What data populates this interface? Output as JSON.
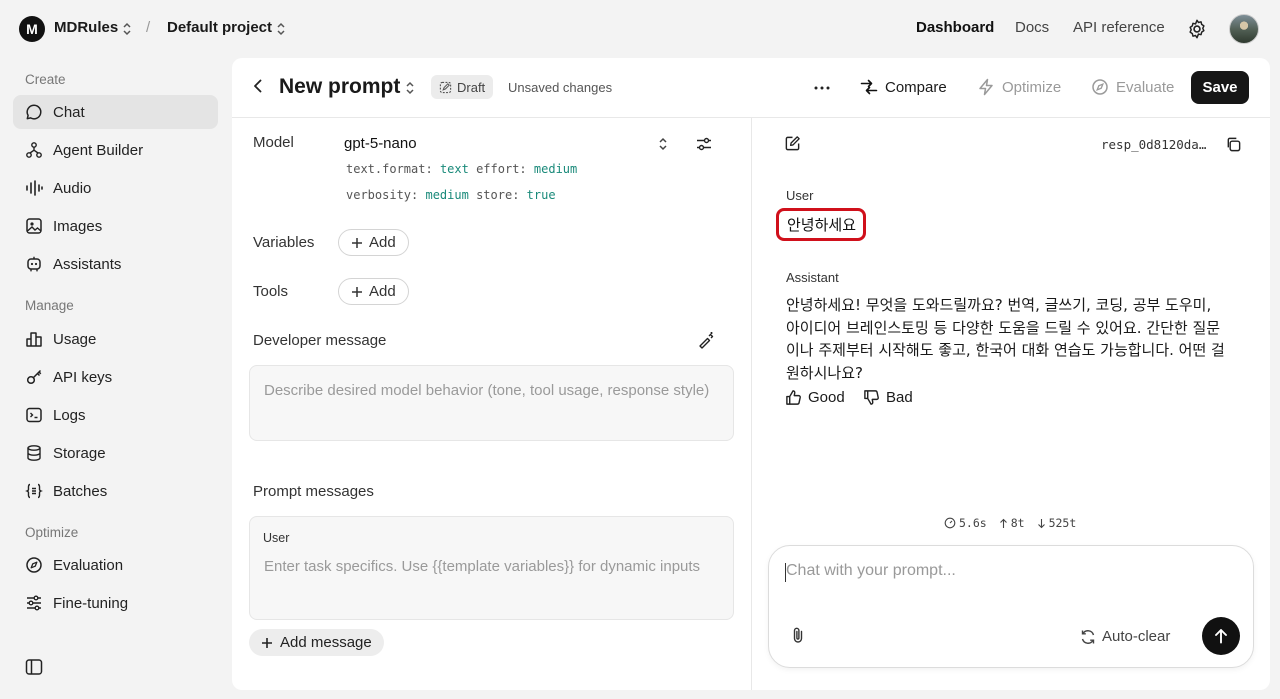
{
  "topbar": {
    "org_initial": "M",
    "org_name": "MDRules",
    "separator": "/",
    "project": "Default project",
    "nav": [
      "Dashboard",
      "Docs",
      "API reference"
    ],
    "active_nav": "Dashboard"
  },
  "sidebar": {
    "sections": [
      {
        "heading": "Create",
        "items": [
          {
            "label": "Chat",
            "icon": "chat-icon",
            "active": true
          },
          {
            "label": "Agent Builder",
            "icon": "agent-builder-icon"
          },
          {
            "label": "Audio",
            "icon": "audio-icon"
          },
          {
            "label": "Images",
            "icon": "images-icon"
          },
          {
            "label": "Assistants",
            "icon": "assistants-icon"
          }
        ]
      },
      {
        "heading": "Manage",
        "items": [
          {
            "label": "Usage",
            "icon": "usage-icon"
          },
          {
            "label": "API keys",
            "icon": "key-icon"
          },
          {
            "label": "Logs",
            "icon": "logs-icon"
          },
          {
            "label": "Storage",
            "icon": "storage-icon"
          },
          {
            "label": "Batches",
            "icon": "batches-icon"
          }
        ]
      },
      {
        "heading": "Optimize",
        "items": [
          {
            "label": "Evaluation",
            "icon": "evaluation-icon"
          },
          {
            "label": "Fine-tuning",
            "icon": "fine-tuning-icon"
          }
        ]
      }
    ]
  },
  "header": {
    "title": "New prompt",
    "badge": "Draft",
    "status": "Unsaved changes",
    "compare": "Compare",
    "optimize": "Optimize",
    "evaluate": "Evaluate",
    "save": "Save"
  },
  "config": {
    "model_label": "Model",
    "model": "gpt-5-nano",
    "params": {
      "format_key": "text.format:",
      "format_val": "text",
      "effort_key": "effort:",
      "effort_val": "medium",
      "verbosity_key": "verbosity:",
      "verbosity_val": "medium",
      "store_key": "store:",
      "store_val": "true"
    },
    "variables_label": "Variables",
    "tools_label": "Tools",
    "add_label": "Add",
    "developer_label": "Developer message",
    "developer_placeholder": "Describe desired model behavior (tone, tool usage, response style)",
    "prompt_messages_label": "Prompt messages",
    "user_role": "User",
    "user_placeholder": "Enter task specifics. Use {{template variables}} for dynamic inputs",
    "add_message": "Add message"
  },
  "chat": {
    "response_id": "resp_0d8120da…",
    "user_role": "User",
    "user_message": "안녕하세요",
    "assistant_role": "Assistant",
    "assistant_message": "안녕하세요! 무엇을 도와드릴까요? 번역, 글쓰기, 코딩, 공부 도우미, 아이디어 브레인스토밍 등 다양한 도움을 드릴 수 있어요. 간단한 질문이나 주제부터 시작해도 좋고, 한국어 대화 연습도 가능합니다. 어떤 걸 원하시나요?",
    "good": "Good",
    "bad": "Bad",
    "stats": {
      "time": "5.6s",
      "input_tokens": "8t",
      "output_tokens": "525t"
    },
    "input_placeholder": "Chat with your prompt...",
    "auto_clear": "Auto-clear"
  },
  "colors": {
    "accent": "#161616",
    "highlight": "#d0101b",
    "param_value": "#1a8a7a"
  }
}
